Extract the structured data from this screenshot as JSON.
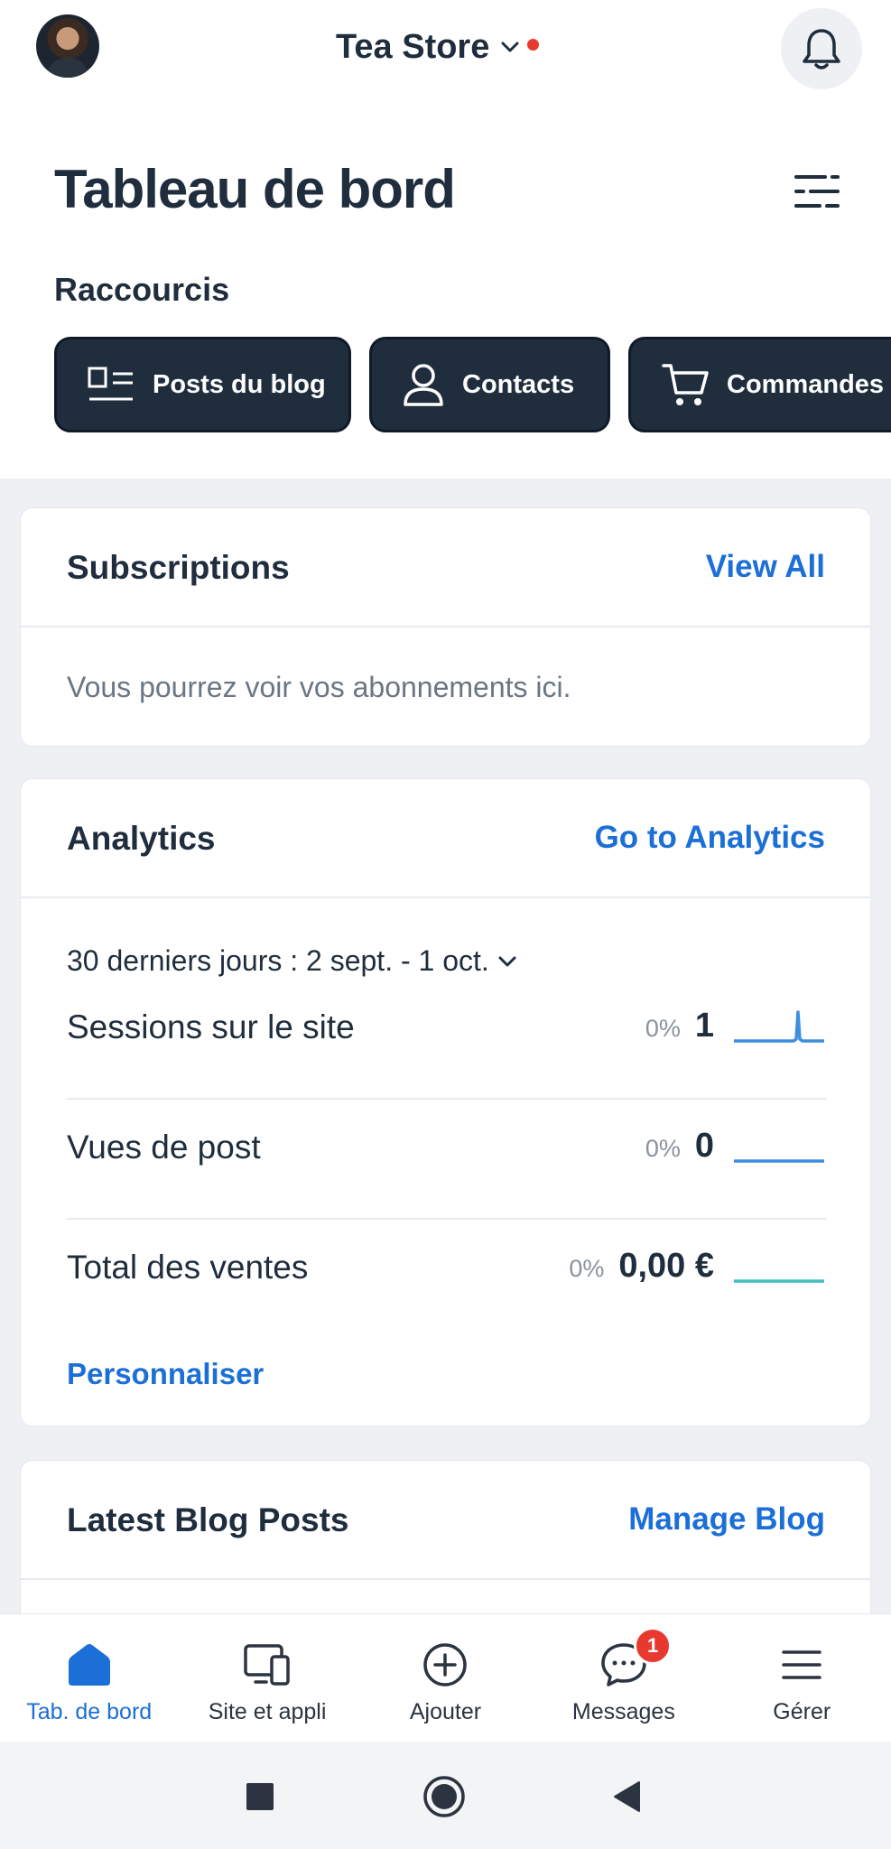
{
  "header": {
    "store_name": "Tea Store"
  },
  "page": {
    "title": "Tableau de bord",
    "shortcuts_title": "Raccourcis"
  },
  "shortcuts": [
    {
      "label": "Posts du blog",
      "icon": "blog-posts-icon"
    },
    {
      "label": "Contacts",
      "icon": "contact-icon"
    },
    {
      "label": "Commandes",
      "icon": "cart-icon"
    }
  ],
  "subscriptions": {
    "title": "Subscriptions",
    "link": "View All",
    "empty_text": "Vous pourrez voir vos abonnements ici."
  },
  "analytics": {
    "title": "Analytics",
    "link": "Go to Analytics",
    "period": "30 derniers jours : 2 sept. - 1 oct.",
    "metrics": [
      {
        "label": "Sessions sur le site",
        "pct": "0%",
        "value": "1",
        "spark_color": "#3d8ee0"
      },
      {
        "label": "Vues de post",
        "pct": "0%",
        "value": "0",
        "spark_color": "#3d8ee0"
      },
      {
        "label": "Total des ventes",
        "pct": "0%",
        "value": "0,00 €",
        "spark_color": "#3fbfbf"
      }
    ],
    "customize": "Personnaliser"
  },
  "blog": {
    "title": "Latest Blog Posts",
    "link": "Manage Blog"
  },
  "bottom_nav": [
    {
      "label": "Tab. de bord",
      "icon": "home-icon",
      "active": true
    },
    {
      "label": "Site et appli",
      "icon": "devices-icon",
      "active": false
    },
    {
      "label": "Ajouter",
      "icon": "add-circle-icon",
      "active": false
    },
    {
      "label": "Messages",
      "icon": "chat-icon",
      "active": false,
      "badge": "1"
    },
    {
      "label": "Gérer",
      "icon": "menu-icon",
      "active": false
    }
  ],
  "colors": {
    "accent": "#1b6fd6",
    "dark": "#1f2d3d",
    "badge": "#e8392f"
  }
}
